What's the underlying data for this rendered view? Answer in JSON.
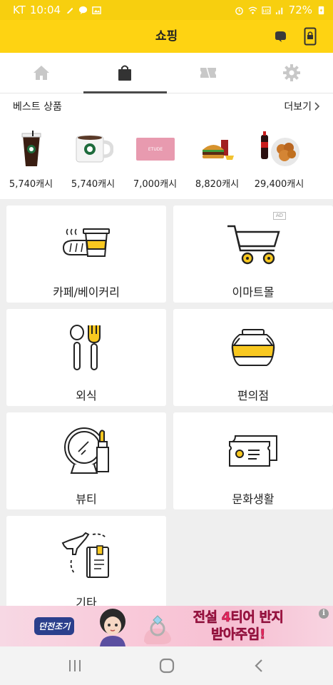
{
  "status_bar": {
    "carrier": "KT",
    "time": "10:04",
    "battery": "72%"
  },
  "header": {
    "title": "쇼핑",
    "icons": [
      "notification-icon",
      "lock-icon"
    ]
  },
  "tabs": [
    {
      "icon": "home-icon",
      "active": false
    },
    {
      "icon": "shopping-bag-icon",
      "active": true
    },
    {
      "icon": "ticket-icon",
      "active": false
    },
    {
      "icon": "gear-icon",
      "active": false
    }
  ],
  "best": {
    "title": "베스트 상품",
    "more": "더보기",
    "products": [
      {
        "image": "iced-coffee",
        "price": "5,740캐시"
      },
      {
        "image": "hot-coffee-mug",
        "price": "5,740캐시"
      },
      {
        "image": "gift-card",
        "price": "7,000캐시"
      },
      {
        "image": "burger-set",
        "price": "8,820캐시"
      },
      {
        "image": "chicken-cola",
        "price": "29,400캐시"
      }
    ]
  },
  "categories": [
    {
      "label": "카페/베이커리",
      "icon": "cafe-bakery-icon"
    },
    {
      "label": "이마트몰",
      "icon": "cart-icon",
      "badge": "AD"
    },
    {
      "label": "외식",
      "icon": "spoon-fork-icon"
    },
    {
      "label": "편의점",
      "icon": "jar-icon"
    },
    {
      "label": "뷰티",
      "icon": "mirror-lipstick-icon"
    },
    {
      "label": "문화생활",
      "icon": "ticket-icon"
    },
    {
      "label": "기타",
      "icon": "plane-book-icon"
    }
  ],
  "banner": {
    "logo": "던전조기",
    "copy_line1": "전설 4티어 반지",
    "copy_line2": "받아주임!",
    "info": "i"
  },
  "colors": {
    "header_yellow": "#fed312",
    "status_yellow": "#f7cf0f",
    "accent_yellow": "#f8c820"
  }
}
